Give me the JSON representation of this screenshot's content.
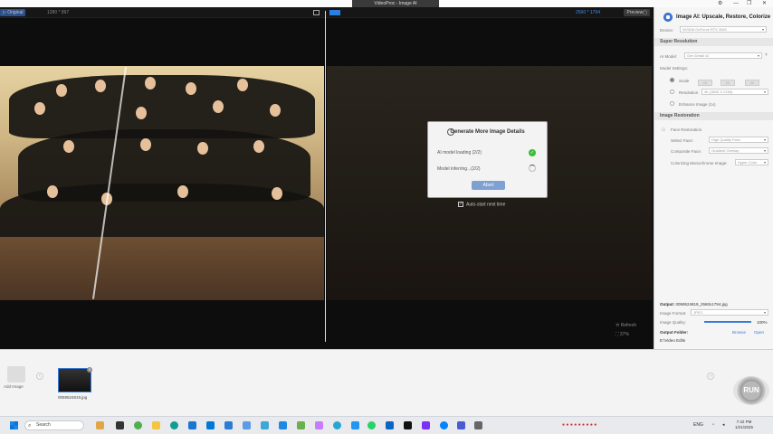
{
  "window": {
    "title": "VideoProc - Image AI",
    "controls": [
      "⚙",
      "—",
      "❐",
      "✕"
    ]
  },
  "preview_bar": {
    "original_label": "▷ Original",
    "original_dims": "1280 * 897",
    "output_dims": "2560 * 1794",
    "preview_label": "Preview▢"
  },
  "dialog": {
    "title": "Generate More Image Details",
    "step1": "AI model loading (2/2)",
    "step2": "Model inferring...(2/2)",
    "abort_label": "Abort",
    "autostart_label": "Auto-start next time",
    "autostart_checked": true
  },
  "zoom": {
    "refresh_label": "Refresh",
    "zoom_value": "37%"
  },
  "panel": {
    "title": "Image AI: Upscale, Restore, Colorize",
    "device_label": "Device:",
    "device_value": "NVIDIA GeForce RTX 3060",
    "sr_header": "Super Resolution",
    "ai_model_label": "AI Model:",
    "ai_model_value": "Gen Detail v2",
    "model_settings_label": "Model Settings:",
    "scale_label": "Scale",
    "scale_options": [
      "2X",
      "3X",
      "4X"
    ],
    "resolution_label": "Resolution",
    "resolution_value": "4K (3840 X 2160)",
    "enhance_label": "Enhance Image (1x)",
    "restoration_header": "Image Restoration",
    "face_restoration_label": "Face Restoration",
    "select_face_label": "Select Face:",
    "select_face_value": "High Quality Face",
    "composite_face_label": "Composite Face:",
    "composite_face_value": "Gradient Overlay",
    "colorizing_label": "Colorizing Monochrome Image:",
    "colorizing_value": "Hyper Color",
    "output_label": "Output:",
    "output_value": "0059524819_2560x1794.jpg",
    "format_label": "Image Format:",
    "format_value": "JPEG",
    "quality_label": "Image Quality:",
    "quality_value": "100%",
    "folder_label": "Output Folder:",
    "browse_label": "Browse",
    "open_label": "Open",
    "folder_path": "E:\\Video Edits"
  },
  "filmstrip": {
    "add_label": "Add Image",
    "thumb_label": "0059524819.jpg",
    "run_label": "RUN"
  },
  "taskbar": {
    "search_placeholder": "Search",
    "lang": "ENG",
    "time": "7:42 PM",
    "date": "1/21/2025"
  },
  "accent": "#3a7bd5"
}
